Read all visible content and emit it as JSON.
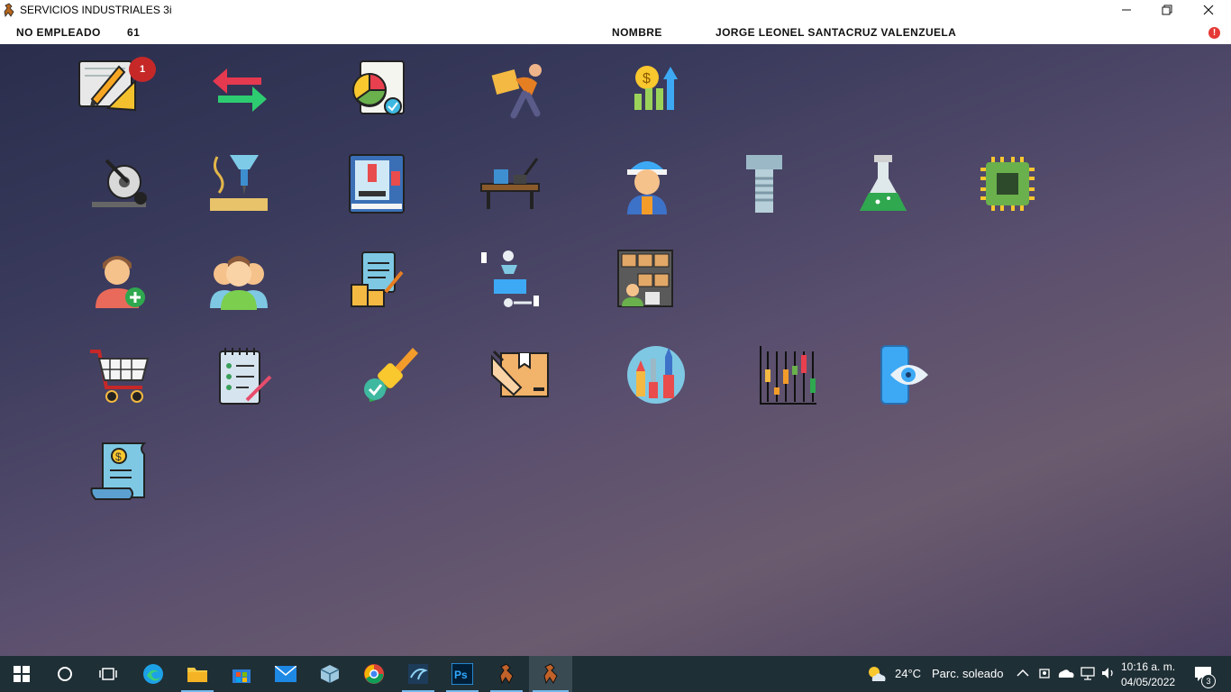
{
  "window": {
    "title": "SERVICIOS INDUSTRIALES 3i",
    "minimize_icon": "minimize-icon",
    "restore_icon": "restore-icon",
    "close_icon": "close-icon"
  },
  "header": {
    "employee_label": "NO EMPLEADO",
    "employee_number": "61",
    "name_label": "NOMBRE",
    "name_value": "JORGE LEONEL SANTACRUZ VALENZUELA",
    "alert_text": "!"
  },
  "tiles": [
    {
      "icon": "blueprint-design-icon",
      "badge": "1"
    },
    {
      "icon": "transfer-arrows-icon"
    },
    {
      "icon": "report-chart-icon"
    },
    {
      "icon": "delivery-person-icon"
    },
    {
      "icon": "finance-growth-icon"
    },
    {
      "icon": "cutting-saw-icon"
    },
    {
      "icon": "milling-machine-icon"
    },
    {
      "icon": "cnc-machine-icon"
    },
    {
      "icon": "workbench-icon"
    },
    {
      "icon": "worker-icon"
    },
    {
      "icon": "bolt-icon"
    },
    {
      "icon": "flask-icon"
    },
    {
      "icon": "chip-icon"
    },
    {
      "icon": "add-user-icon"
    },
    {
      "icon": "users-group-icon"
    },
    {
      "icon": "inventory-checklist-icon"
    },
    {
      "icon": "process-flow-icon"
    },
    {
      "icon": "warehouse-shelf-icon"
    },
    {
      "icon": "shopping-cart-icon"
    },
    {
      "icon": "notepad-checklist-icon"
    },
    {
      "icon": "paint-brush-icon"
    },
    {
      "icon": "package-handshake-icon"
    },
    {
      "icon": "tools-icon"
    },
    {
      "icon": "candlestick-chart-icon"
    },
    {
      "icon": "mobile-view-icon"
    },
    {
      "icon": "invoice-scroll-icon"
    }
  ],
  "taskbar": {
    "weather_temp": "24°C",
    "weather_desc": "Parc. soleado",
    "time": "10:16 a. m.",
    "date": "04/05/2022",
    "notifications": "3",
    "apps": [
      "start-icon",
      "search-icon",
      "task-view-icon",
      "edge-icon",
      "file-explorer-icon",
      "store-icon",
      "mail-icon",
      "box-app-icon",
      "chrome-icon",
      "mysql-workbench-icon",
      "photoshop-icon",
      "app-3i-icon",
      "app-3i-active-icon"
    ]
  }
}
